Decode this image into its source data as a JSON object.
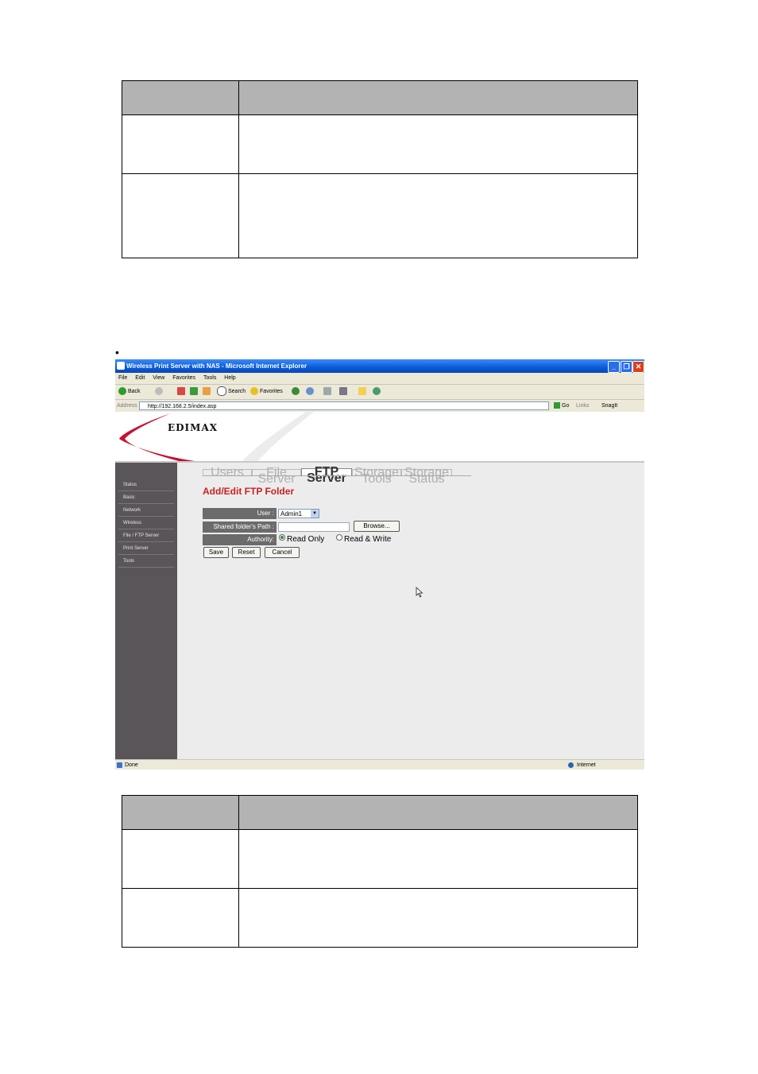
{
  "bullet": "•",
  "window": {
    "title": "Wireless Print Server with NAS - Microsoft Internet Explorer",
    "controls": [
      "_",
      "❐",
      "✕"
    ]
  },
  "menubar": [
    "File",
    "Edit",
    "View",
    "Favorites",
    "Tools",
    "Help"
  ],
  "toolbar": {
    "back": "Back",
    "search": "Search",
    "favorites": "Favorites"
  },
  "address": {
    "label": "Address",
    "url": "http://192.168.2.5/index.asp",
    "go": "Go",
    "links": "Links",
    "snagit": "SnagIt"
  },
  "brand": {
    "logo": "EDIMAX"
  },
  "sidebar": {
    "items": [
      "Status",
      "Basic",
      "Network",
      "Wireless",
      "File / FTP Server",
      "Print Server",
      "Tools"
    ]
  },
  "tabs": [
    "Users",
    "File Server",
    "FTP Server",
    "Storage Tools",
    "Storage Status"
  ],
  "form": {
    "title": "Add/Edit FTP Folder",
    "user_label": "User :",
    "user_value": "Admin1",
    "path_label": "Shared folder's Path :",
    "path_value": "",
    "browse": "Browse...",
    "authority_label": "Authority:",
    "read_only": "Read Only",
    "read_write": "Read & Write",
    "save": "Save",
    "reset": "Reset",
    "cancel": "Cancel"
  },
  "statusbar": {
    "left": "Done",
    "zone": "Internet"
  }
}
